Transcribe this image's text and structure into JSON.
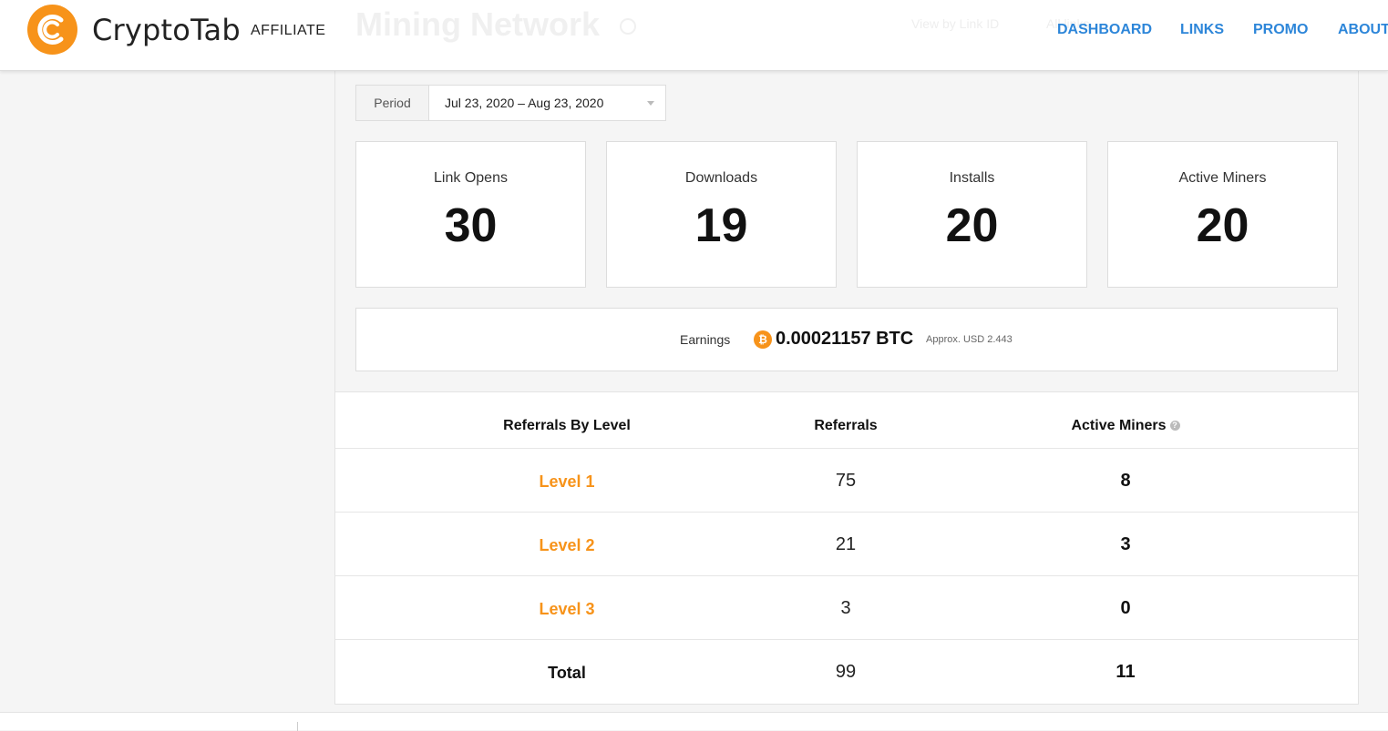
{
  "header": {
    "brand": "CryptoTab",
    "brand_sub": "AFFILIATE",
    "ghost_title": "Mining Network",
    "ghost_link_1": "View by Link ID",
    "ghost_link_2": "All links",
    "nav": [
      "DASHBOARD",
      "LINKS",
      "PROMO",
      "ABOUT"
    ]
  },
  "period": {
    "label": "Period",
    "value": "Jul 23, 2020 – Aug 23, 2020"
  },
  "stats": [
    {
      "label": "Link Opens",
      "value": "30"
    },
    {
      "label": "Downloads",
      "value": "19"
    },
    {
      "label": "Installs",
      "value": "20"
    },
    {
      "label": "Active Miners",
      "value": "20"
    }
  ],
  "earnings": {
    "label": "Earnings",
    "coin_symbol": "₿",
    "value": "0.00021157 BTC",
    "approx": "Approx. USD 2.443"
  },
  "referrals_table": {
    "headers": [
      "Referrals By Level",
      "Referrals",
      "Active Miners"
    ],
    "help_glyph": "?",
    "rows": [
      {
        "level": "Level 1",
        "referrals": "75",
        "active_miners": "8"
      },
      {
        "level": "Level 2",
        "referrals": "21",
        "active_miners": "3"
      },
      {
        "level": "Level 3",
        "referrals": "3",
        "active_miners": "0"
      }
    ],
    "total": {
      "label": "Total",
      "referrals": "99",
      "active_miners": "11"
    }
  },
  "colors": {
    "accent_orange": "#f7931a",
    "nav_blue": "#2d86d9",
    "background": "#f5f5f5"
  }
}
